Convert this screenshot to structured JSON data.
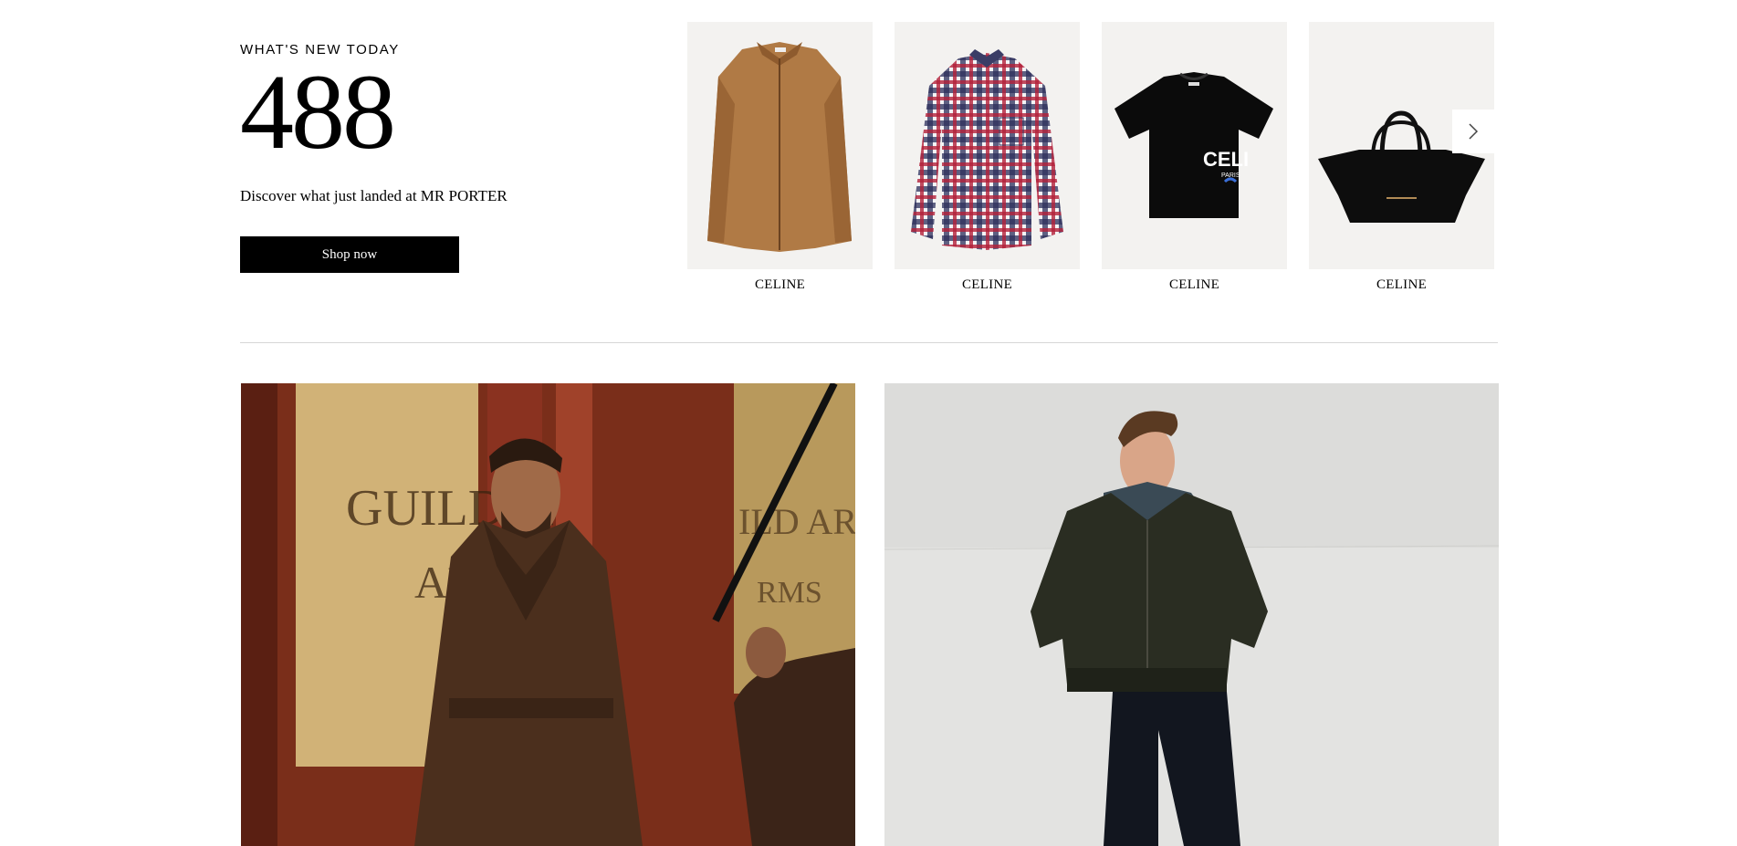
{
  "whats_new": {
    "eyebrow": "WHAT'S NEW TODAY",
    "count": "488",
    "tagline": "Discover what just landed at MR PORTER",
    "cta_label": "Shop now"
  },
  "products": [
    {
      "brand": "CELINE",
      "icon": "leather-jacket-image"
    },
    {
      "brand": "CELINE",
      "icon": "check-shirt-image"
    },
    {
      "brand": "CELINE",
      "icon": "logo-tshirt-image",
      "print_text": "CELI",
      "print_subtext": "PARIS"
    },
    {
      "brand": "CELINE",
      "icon": "tote-bag-image"
    }
  ],
  "carousel": {
    "next_icon": "chevron-right-icon"
  },
  "editorial": [
    {
      "icon": "editorial-leather-coat-image",
      "sign_line1": "GUILD H",
      "sign_line2": "ARI",
      "sign_line3": "ILD ARA",
      "sign_line4": "RMS"
    },
    {
      "icon": "editorial-bomber-jacket-image"
    }
  ],
  "colors": {
    "button_bg": "#000000",
    "thumb_bg": "#f3f2f0",
    "divider": "#d6d6d6"
  }
}
